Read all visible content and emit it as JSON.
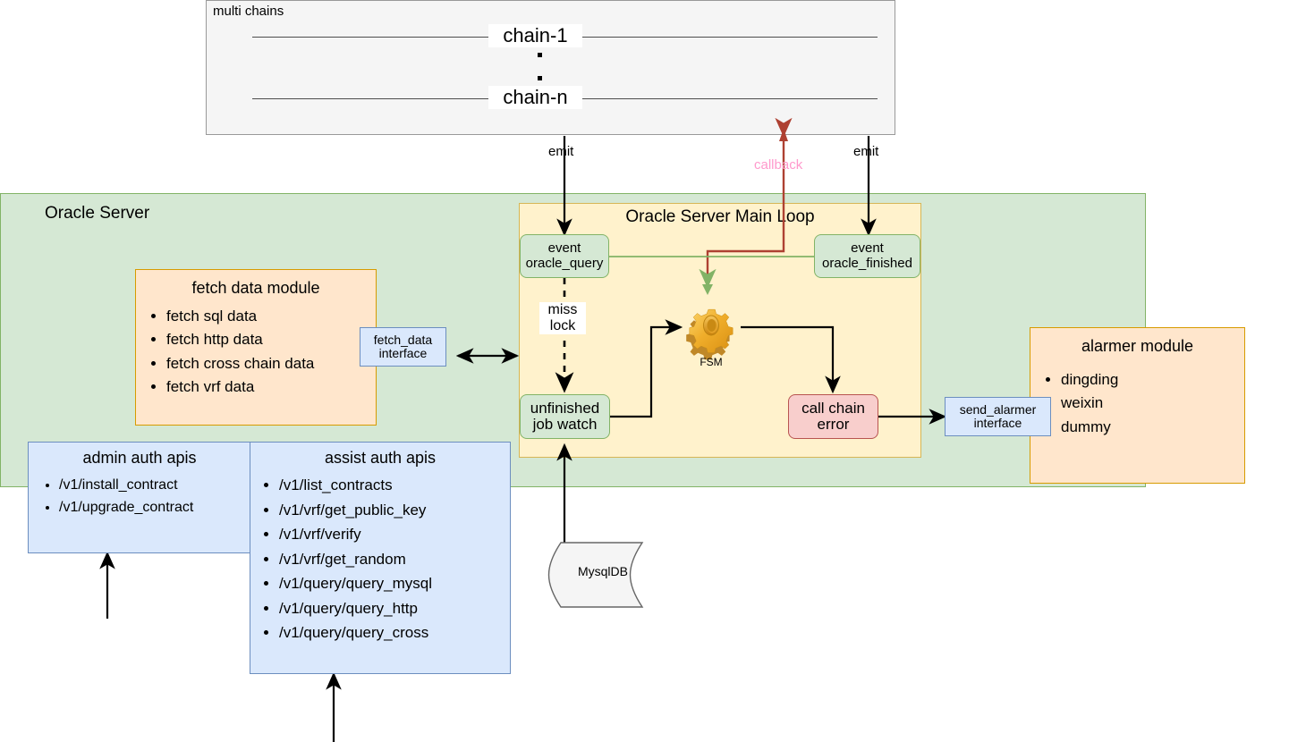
{
  "diagram": {
    "chains": {
      "title": "multi chains",
      "first": "chain-1",
      "last": "chain-n"
    },
    "oracle_server": {
      "title": "Oracle Server",
      "fill": "#d5e8d4",
      "stroke": "#82b366"
    },
    "main_loop": {
      "title": "Oracle Server Main Loop",
      "fill": "#fff2cc",
      "stroke": "#d6b656",
      "nodes": {
        "event_query_line1": "event",
        "event_query_line2": "oracle_query",
        "event_finished_line1": "event",
        "event_finished_line2": "oracle_finished",
        "unfinished_line1": "unfinished",
        "unfinished_line2": "job watch",
        "call_chain_error_line1": "call chain",
        "call_chain_error_line2": "error",
        "fsm_label": "FSM"
      }
    },
    "fetch_module": {
      "title": "fetch data module",
      "items": [
        "fetch sql data",
        "fetch http data",
        "fetch cross chain data",
        "fetch vrf data"
      ],
      "fill": "#ffe6cc",
      "stroke": "#d79b00"
    },
    "fetch_interface": {
      "line1": "fetch_data",
      "line2": "interface"
    },
    "alarmer_module": {
      "title": "alarmer module",
      "items": [
        "dingding",
        "weixin",
        "dummy"
      ],
      "fill": "#ffe6cc",
      "stroke": "#d79b00"
    },
    "alarmer_interface": {
      "line1": "send_alarmer",
      "line2": "interface"
    },
    "admin_apis": {
      "title": "admin auth apis",
      "items": [
        "/v1/install_contract",
        "/v1/upgrade_contract"
      ],
      "fill": "#dae8fc",
      "stroke": "#6c8ebf"
    },
    "assist_apis": {
      "title": "assist auth apis",
      "items": [
        "/v1/list_contracts",
        "/v1/vrf/get_public_key",
        "/v1/vrf/verify",
        "/v1/vrf/get_random",
        "/v1/query/query_mysql",
        "/v1/query/query_http",
        "/v1/query/query_cross"
      ],
      "fill": "#dae8fc",
      "stroke": "#6c8ebf"
    },
    "database": {
      "label": "MysqlDB",
      "fill": "#f5f5f5",
      "stroke": "#666666"
    },
    "edges": {
      "emit_left": "emit",
      "emit_right": "emit",
      "callback": "callback",
      "callback_color": "#ff99cc",
      "callback_line_color": "#ae4132",
      "miss_lock_line1": "miss",
      "miss_lock_line2": "lock"
    }
  }
}
